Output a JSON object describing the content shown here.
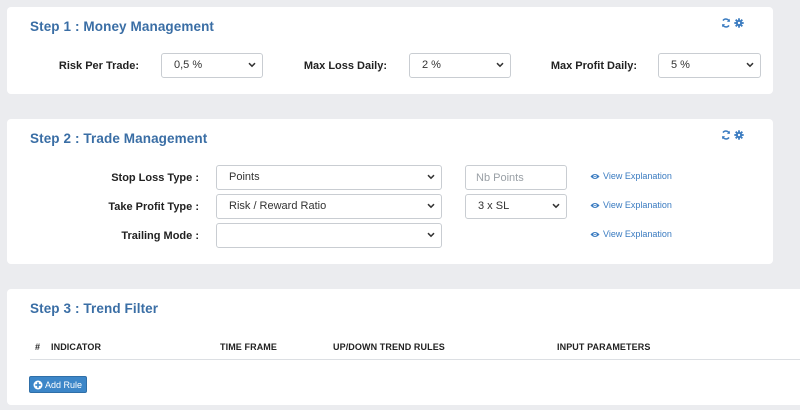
{
  "step1": {
    "title": "Step 1 : Money Management",
    "risk_label": "Risk Per Trade:",
    "risk_value": "0,5 %",
    "maxloss_label": "Max Loss Daily:",
    "maxloss_value": "2 %",
    "maxprofit_label": "Max Profit Daily:",
    "maxprofit_value": "5 %"
  },
  "step2": {
    "title": "Step 2 : Trade Management",
    "sl_label": "Stop Loss Type :",
    "sl_value": "Points",
    "sl_points_placeholder": "Nb Points",
    "tp_label": "Take Profit Type :",
    "tp_value": "Risk / Reward Ratio",
    "tp_ratio_value": "3 x SL",
    "trailing_label": "Trailing Mode :",
    "trailing_value": "",
    "explanation_link": "View Explanation"
  },
  "step3": {
    "title": "Step 3 : Trend Filter",
    "columns": [
      "#",
      "INDICATOR",
      "TIME FRAME",
      "UP/DOWN TREND RULES",
      "INPUT PARAMETERS"
    ],
    "add_rule_label": "Add Rule"
  },
  "icons": {
    "refresh": "refresh-icon",
    "settings": "gear-icon",
    "eye": "eye-icon",
    "plus": "plus-circle-icon"
  },
  "colors": {
    "accent": "#3a6ea5",
    "link": "#3a7bc0",
    "button": "#3c86c8",
    "background": "#ebecef"
  }
}
